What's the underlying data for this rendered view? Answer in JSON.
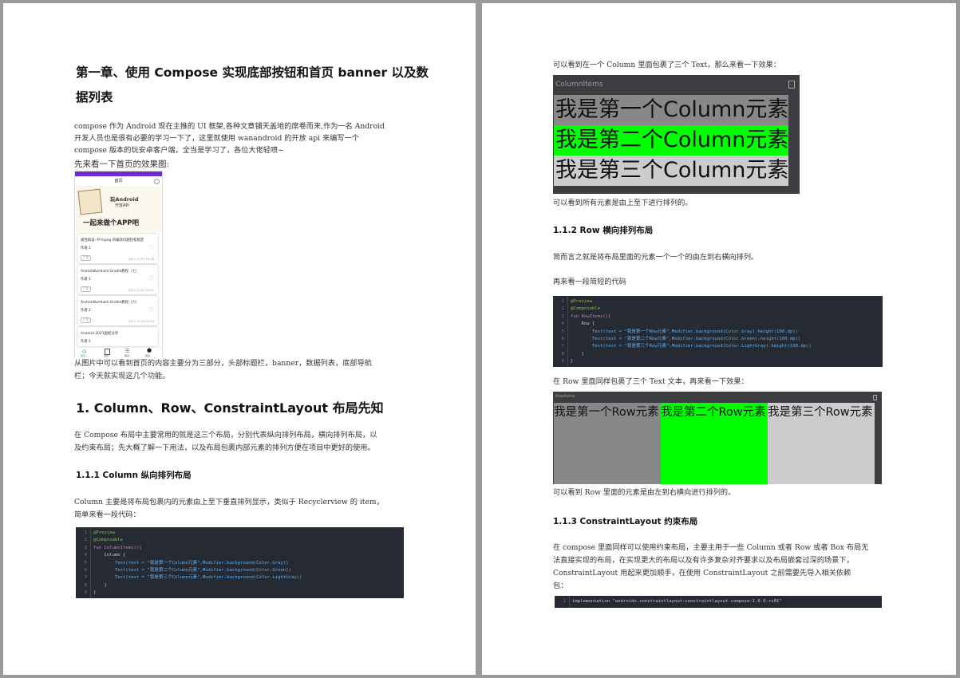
{
  "left": {
    "chapter_title_1": "第一章、使用 Compose 实现底部按钮和首页 banner 以及数",
    "chapter_title_2": "据列表",
    "intro_1": "compose 作为 Android 现在主推的 UI 框架,各种文章铺天盖地的席卷而来,作为一名 Android",
    "intro_2": "开发人员也是很有必要的学习一下了，这里就使用 wanandroid 的开放 api 来编写一个",
    "intro_3": "compose 版本的玩安卓客户端，全当是学习了，各位大佬轻喷~",
    "see_home": "先来看一下首页的效果图:",
    "phone": {
      "title": "首页",
      "banner_line1": "玩Android",
      "banner_line2": "开放API",
      "banner_slogan": "一起来做个APP吧",
      "cards": [
        {
          "title": "极性再谈--FFmpeg 的编译问题轻松搞定",
          "author": "作者:1",
          "tag": "广告",
          "date": "2021-11-07 10:38"
        },
        {
          "title": "Android&mdash;Gradle教程（七）",
          "author": "作者:1",
          "tag": "广告",
          "date": "2021-11-05 22:41"
        },
        {
          "title": "Android&mdash;Gradle教程（六）",
          "author": "作者:1",
          "tag": "广告",
          "date": "2021-11-04 23:24"
        },
        {
          "title": "Android 2021面经分享",
          "author": "作者:1",
          "tag": "",
          "date": ""
        }
      ],
      "nav": [
        "首页",
        "项目",
        "体系",
        "我的"
      ]
    },
    "after_phone_1": "从图片中可以看到首页的内容主要分为三部分，头部标题栏，banner，数据列表，底部导航",
    "after_phone_2": "栏；今天就实现这几个功能。",
    "section1_title": "1.  Column、Row、ConstraintLayout 布局先知",
    "section1_p1": "在 Compose 布局中主要常用的就是这三个布局，分别代表纵向排列布局，横向排列布局，以",
    "section1_p2": "及约束布局；先大概了解一下用法，以及布局包裹内部元素的排列方便在项目中更好的使用。",
    "sub111": "1.1.1 Column 纵向排列布局",
    "col_p1": "Column 主要是将布局包裹内的元素由上至下垂直排列显示，类似于 Recyclerview 的 item，",
    "col_p2": "简单来看一段代码：",
    "code1": [
      {
        "n": "1",
        "t": "@Preview"
      },
      {
        "n": "2",
        "t": "@Composable"
      },
      {
        "n": "3",
        "t": "fun ColumnItems(){"
      },
      {
        "n": "4",
        "t": "    Column {"
      },
      {
        "n": "5",
        "t": "        Text(text = \"我是第一个Column元素\",Modifier.background(Color.Gray))"
      },
      {
        "n": "6",
        "t": "        Text(text = \"我是第二个Column元素\",Modifier.background(Color.Green))"
      },
      {
        "n": "7",
        "t": "        Text(text = \"我是第三个Column元素\",Modifier.background(Color.LightGray))"
      },
      {
        "n": "8",
        "t": "    }"
      },
      {
        "n": "9",
        "t": "}"
      }
    ]
  },
  "right": {
    "col_desc": "可以看到在一个 Column 里面包裹了三个 Text，那么来看一下效果：",
    "column_shot_title": "ColumnItems",
    "column_items": [
      "我是第一个Column元素",
      "我是第二个Column元素",
      "我是第三个Column元素"
    ],
    "col_result": "可以看到所有元素是由上至下进行排列的。",
    "sub112": "1.1.2 Row 横向排列布局",
    "row_p1": "简而言之就是将布局里面的元素一个一个的由左到右横向排列。",
    "row_p2": "再来看一段简短的代码",
    "code2": [
      {
        "n": "1",
        "t": "@Preview"
      },
      {
        "n": "2",
        "t": "@Composable"
      },
      {
        "n": "3",
        "t": "fun RowItems(){"
      },
      {
        "n": "4",
        "t": "    Row {"
      },
      {
        "n": "5",
        "t": "        Text(text = \"我是第一个Row元素\",Modifier.background(Color.Gray).height(100.dp))"
      },
      {
        "n": "6",
        "t": "        Text(text = \"我是第二个Row元素\",Modifier.background(Color.Green).height(100.dp))"
      },
      {
        "n": "7",
        "t": "        Text(text = \"我是第三个Row元素\",Modifier.background(Color.LightGray).height(100.dp))"
      },
      {
        "n": "8",
        "t": "    }"
      },
      {
        "n": "9",
        "t": "}"
      }
    ],
    "row_desc": "在 Row 里面同样包裹了三个 Text 文本，再来看一下效果：",
    "row_shot_title": "RowItems",
    "row_items": [
      "我是第一个Row元素",
      "我是第二个Row元素",
      "我是第三个Row元素"
    ],
    "row_result": "可以看到 Row 里面的元素是由左到右横向进行排列的。",
    "sub113": "1.1.3 ConstraintLayout 约束布局",
    "cl_p1": "在 compose 里面同样可以使用约束布局，主要主用于一些 Column 或者 Row 或者 Box 布局无",
    "cl_p2": "法直接实现的布局，在实现更大的布局以及有许多复杂对齐要求以及布局嵌套过深的场景下，",
    "cl_p3": "ConstraintLayout 用起来更加顺手，在使用 ConstraintLayout 之前需要先导入相关依赖",
    "cl_p4": "包：",
    "code3": [
      {
        "n": "1",
        "t": "implementation \"androidx.constraintlayout:constraintlayout-compose:1.0.0-rc01\""
      }
    ]
  },
  "colors": {
    "gray": "#888888",
    "green": "#00ff00",
    "lightgray": "#cccccc",
    "code_bg": "#262a33"
  }
}
